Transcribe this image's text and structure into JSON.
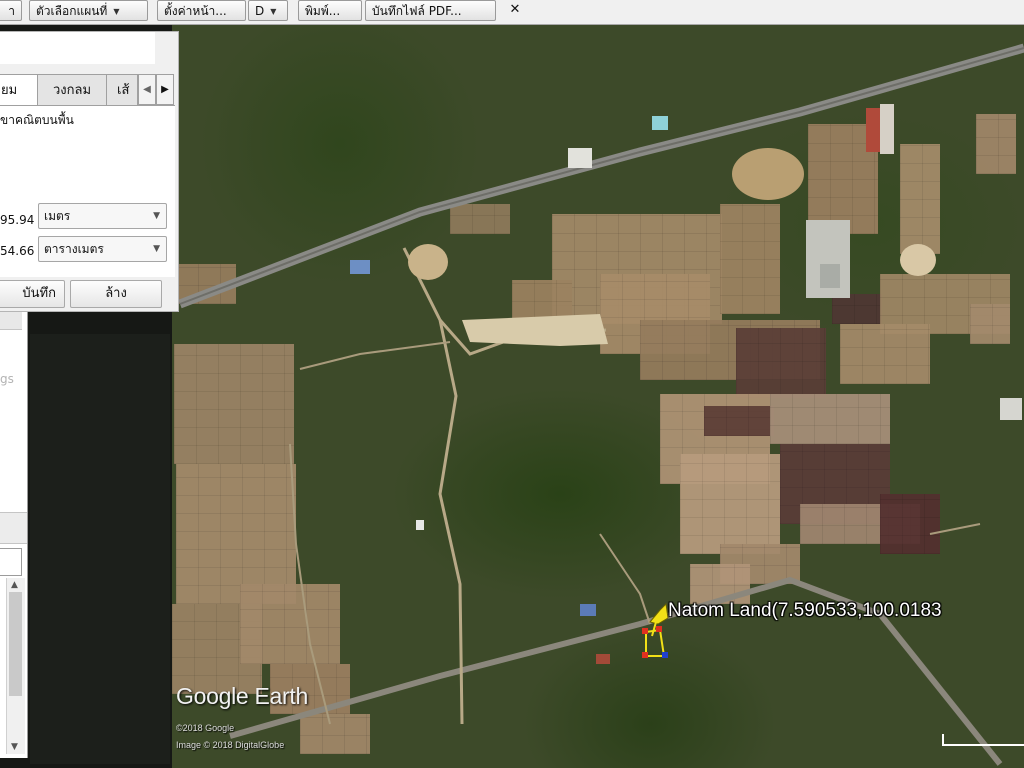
{
  "toolbar": {
    "items": [
      {
        "label": "า",
        "has_dropdown": false
      },
      {
        "label": "ตัวเลือกแผนที่",
        "has_dropdown": true
      },
      {
        "label": "ตั้งค่าหน้า...",
        "has_dropdown": false
      },
      {
        "label": "D",
        "has_dropdown": true
      },
      {
        "label": "พิมพ์...",
        "has_dropdown": false
      },
      {
        "label": "บันทึกไฟล์ PDF...",
        "has_dropdown": false
      }
    ],
    "close_glyph": "✕"
  },
  "ruler": {
    "tabs": [
      "ยม",
      "วงกลม",
      "เส้"
    ],
    "active_tab": 0,
    "description": "ขาคณิตบนพื้น",
    "rows": [
      {
        "value": "95.94",
        "unit": "เมตร"
      },
      {
        "value": "54.66",
        "unit": "ตารางเมตร"
      }
    ],
    "save_label": "บันทึก",
    "clear_label": "ล้าง"
  },
  "side_panel": {
    "ghost_text": "gs"
  },
  "map": {
    "place_label": "Natom Land(7.590533,100.0183",
    "logo": "Google Earth",
    "credit_1": "©2018 Google",
    "credit_2": "Image © 2018 DigitalGlobe",
    "placemark_color": "#f2e017",
    "polygon_colors": [
      "#e03020",
      "#2040d0",
      "#f2e017"
    ]
  }
}
